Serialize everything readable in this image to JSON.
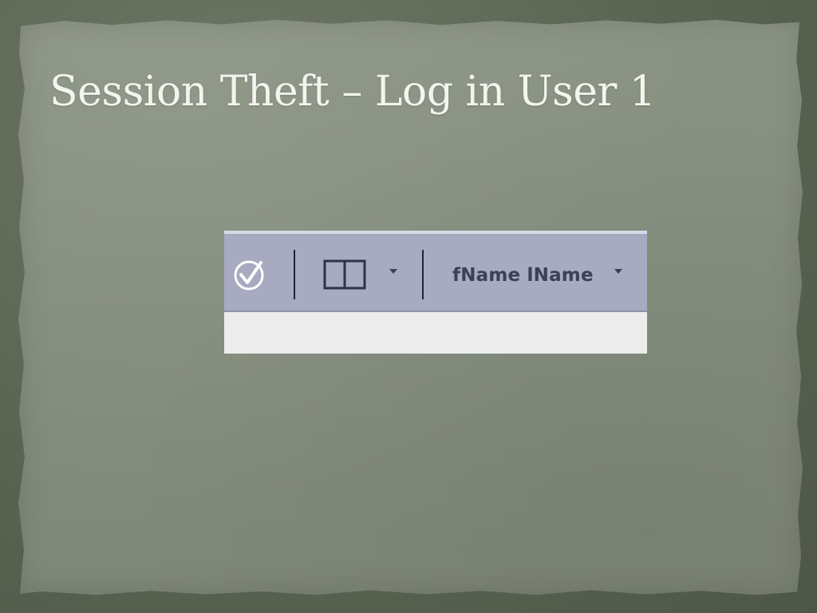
{
  "slide": {
    "title": "Session Theft – Log in User 1"
  },
  "screenshot": {
    "toolbar": {
      "check_icon": "check-circle-icon",
      "layout_icon": "split-panel-icon",
      "layout_dropdown_icon": "caret-down-icon",
      "user_name": "fName lName",
      "user_dropdown_icon": "caret-down-icon"
    }
  }
}
